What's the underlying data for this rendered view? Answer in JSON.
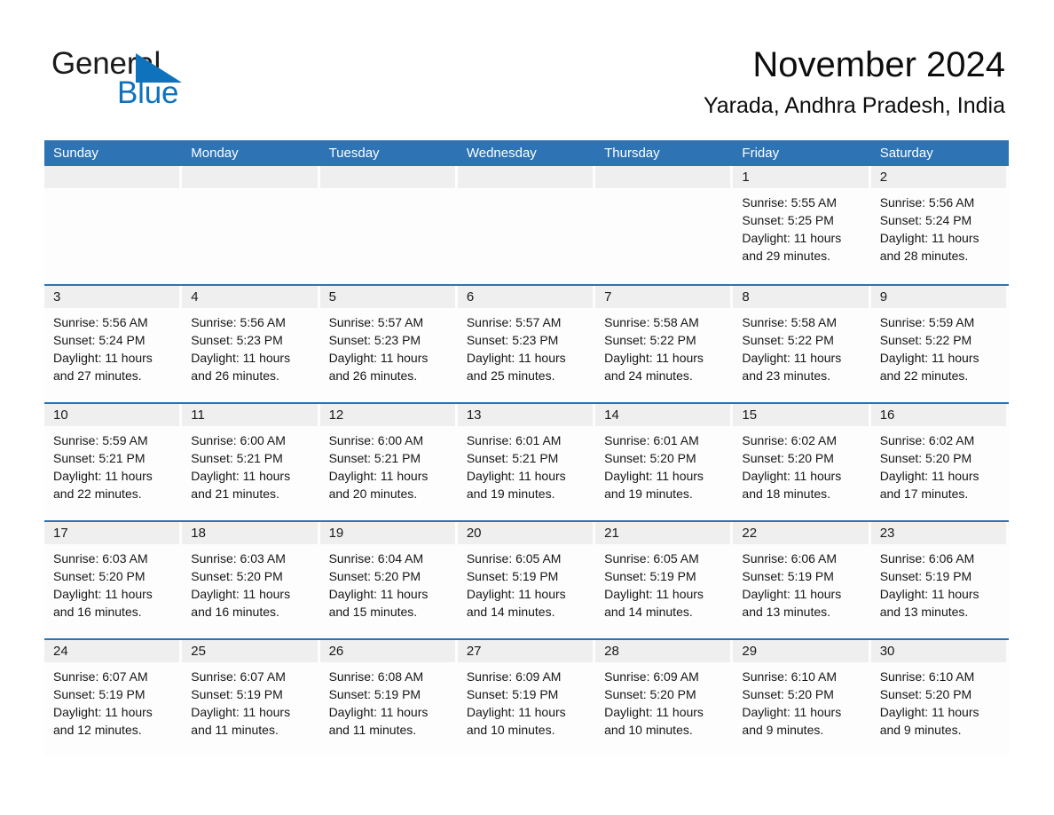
{
  "brand": {
    "word_one": "General",
    "word_two": "Blue",
    "flag_icon": "triangle-flag-icon",
    "accent_color": "#0f72bd"
  },
  "header": {
    "month_title": "November 2024",
    "location": "Yarada, Andhra Pradesh, India"
  },
  "theme": {
    "header_blue": "#2e74b5",
    "day_band_gray": "#efefef",
    "cell_white": "#fdfdfd",
    "text_dark": "#1a1a1a"
  },
  "weekdays": [
    "Sunday",
    "Monday",
    "Tuesday",
    "Wednesday",
    "Thursday",
    "Friday",
    "Saturday"
  ],
  "weeks": [
    [
      {
        "day": "",
        "empty": true,
        "sunrise": "",
        "sunset": "",
        "daylight_1": "",
        "daylight_2": ""
      },
      {
        "day": "",
        "empty": true,
        "sunrise": "",
        "sunset": "",
        "daylight_1": "",
        "daylight_2": ""
      },
      {
        "day": "",
        "empty": true,
        "sunrise": "",
        "sunset": "",
        "daylight_1": "",
        "daylight_2": ""
      },
      {
        "day": "",
        "empty": true,
        "sunrise": "",
        "sunset": "",
        "daylight_1": "",
        "daylight_2": ""
      },
      {
        "day": "",
        "empty": true,
        "sunrise": "",
        "sunset": "",
        "daylight_1": "",
        "daylight_2": ""
      },
      {
        "day": "1",
        "sunrise": "Sunrise: 5:55 AM",
        "sunset": "Sunset: 5:25 PM",
        "daylight_1": "Daylight: 11 hours",
        "daylight_2": "and 29 minutes."
      },
      {
        "day": "2",
        "sunrise": "Sunrise: 5:56 AM",
        "sunset": "Sunset: 5:24 PM",
        "daylight_1": "Daylight: 11 hours",
        "daylight_2": "and 28 minutes."
      }
    ],
    [
      {
        "day": "3",
        "sunrise": "Sunrise: 5:56 AM",
        "sunset": "Sunset: 5:24 PM",
        "daylight_1": "Daylight: 11 hours",
        "daylight_2": "and 27 minutes."
      },
      {
        "day": "4",
        "sunrise": "Sunrise: 5:56 AM",
        "sunset": "Sunset: 5:23 PM",
        "daylight_1": "Daylight: 11 hours",
        "daylight_2": "and 26 minutes."
      },
      {
        "day": "5",
        "sunrise": "Sunrise: 5:57 AM",
        "sunset": "Sunset: 5:23 PM",
        "daylight_1": "Daylight: 11 hours",
        "daylight_2": "and 26 minutes."
      },
      {
        "day": "6",
        "sunrise": "Sunrise: 5:57 AM",
        "sunset": "Sunset: 5:23 PM",
        "daylight_1": "Daylight: 11 hours",
        "daylight_2": "and 25 minutes."
      },
      {
        "day": "7",
        "sunrise": "Sunrise: 5:58 AM",
        "sunset": "Sunset: 5:22 PM",
        "daylight_1": "Daylight: 11 hours",
        "daylight_2": "and 24 minutes."
      },
      {
        "day": "8",
        "sunrise": "Sunrise: 5:58 AM",
        "sunset": "Sunset: 5:22 PM",
        "daylight_1": "Daylight: 11 hours",
        "daylight_2": "and 23 minutes."
      },
      {
        "day": "9",
        "sunrise": "Sunrise: 5:59 AM",
        "sunset": "Sunset: 5:22 PM",
        "daylight_1": "Daylight: 11 hours",
        "daylight_2": "and 22 minutes."
      }
    ],
    [
      {
        "day": "10",
        "sunrise": "Sunrise: 5:59 AM",
        "sunset": "Sunset: 5:21 PM",
        "daylight_1": "Daylight: 11 hours",
        "daylight_2": "and 22 minutes."
      },
      {
        "day": "11",
        "sunrise": "Sunrise: 6:00 AM",
        "sunset": "Sunset: 5:21 PM",
        "daylight_1": "Daylight: 11 hours",
        "daylight_2": "and 21 minutes."
      },
      {
        "day": "12",
        "sunrise": "Sunrise: 6:00 AM",
        "sunset": "Sunset: 5:21 PM",
        "daylight_1": "Daylight: 11 hours",
        "daylight_2": "and 20 minutes."
      },
      {
        "day": "13",
        "sunrise": "Sunrise: 6:01 AM",
        "sunset": "Sunset: 5:21 PM",
        "daylight_1": "Daylight: 11 hours",
        "daylight_2": "and 19 minutes."
      },
      {
        "day": "14",
        "sunrise": "Sunrise: 6:01 AM",
        "sunset": "Sunset: 5:20 PM",
        "daylight_1": "Daylight: 11 hours",
        "daylight_2": "and 19 minutes."
      },
      {
        "day": "15",
        "sunrise": "Sunrise: 6:02 AM",
        "sunset": "Sunset: 5:20 PM",
        "daylight_1": "Daylight: 11 hours",
        "daylight_2": "and 18 minutes."
      },
      {
        "day": "16",
        "sunrise": "Sunrise: 6:02 AM",
        "sunset": "Sunset: 5:20 PM",
        "daylight_1": "Daylight: 11 hours",
        "daylight_2": "and 17 minutes."
      }
    ],
    [
      {
        "day": "17",
        "sunrise": "Sunrise: 6:03 AM",
        "sunset": "Sunset: 5:20 PM",
        "daylight_1": "Daylight: 11 hours",
        "daylight_2": "and 16 minutes."
      },
      {
        "day": "18",
        "sunrise": "Sunrise: 6:03 AM",
        "sunset": "Sunset: 5:20 PM",
        "daylight_1": "Daylight: 11 hours",
        "daylight_2": "and 16 minutes."
      },
      {
        "day": "19",
        "sunrise": "Sunrise: 6:04 AM",
        "sunset": "Sunset: 5:20 PM",
        "daylight_1": "Daylight: 11 hours",
        "daylight_2": "and 15 minutes."
      },
      {
        "day": "20",
        "sunrise": "Sunrise: 6:05 AM",
        "sunset": "Sunset: 5:19 PM",
        "daylight_1": "Daylight: 11 hours",
        "daylight_2": "and 14 minutes."
      },
      {
        "day": "21",
        "sunrise": "Sunrise: 6:05 AM",
        "sunset": "Sunset: 5:19 PM",
        "daylight_1": "Daylight: 11 hours",
        "daylight_2": "and 14 minutes."
      },
      {
        "day": "22",
        "sunrise": "Sunrise: 6:06 AM",
        "sunset": "Sunset: 5:19 PM",
        "daylight_1": "Daylight: 11 hours",
        "daylight_2": "and 13 minutes."
      },
      {
        "day": "23",
        "sunrise": "Sunrise: 6:06 AM",
        "sunset": "Sunset: 5:19 PM",
        "daylight_1": "Daylight: 11 hours",
        "daylight_2": "and 13 minutes."
      }
    ],
    [
      {
        "day": "24",
        "sunrise": "Sunrise: 6:07 AM",
        "sunset": "Sunset: 5:19 PM",
        "daylight_1": "Daylight: 11 hours",
        "daylight_2": "and 12 minutes."
      },
      {
        "day": "25",
        "sunrise": "Sunrise: 6:07 AM",
        "sunset": "Sunset: 5:19 PM",
        "daylight_1": "Daylight: 11 hours",
        "daylight_2": "and 11 minutes."
      },
      {
        "day": "26",
        "sunrise": "Sunrise: 6:08 AM",
        "sunset": "Sunset: 5:19 PM",
        "daylight_1": "Daylight: 11 hours",
        "daylight_2": "and 11 minutes."
      },
      {
        "day": "27",
        "sunrise": "Sunrise: 6:09 AM",
        "sunset": "Sunset: 5:19 PM",
        "daylight_1": "Daylight: 11 hours",
        "daylight_2": "and 10 minutes."
      },
      {
        "day": "28",
        "sunrise": "Sunrise: 6:09 AM",
        "sunset": "Sunset: 5:20 PM",
        "daylight_1": "Daylight: 11 hours",
        "daylight_2": "and 10 minutes."
      },
      {
        "day": "29",
        "sunrise": "Sunrise: 6:10 AM",
        "sunset": "Sunset: 5:20 PM",
        "daylight_1": "Daylight: 11 hours",
        "daylight_2": "and 9 minutes."
      },
      {
        "day": "30",
        "sunrise": "Sunrise: 6:10 AM",
        "sunset": "Sunset: 5:20 PM",
        "daylight_1": "Daylight: 11 hours",
        "daylight_2": "and 9 minutes."
      }
    ]
  ]
}
